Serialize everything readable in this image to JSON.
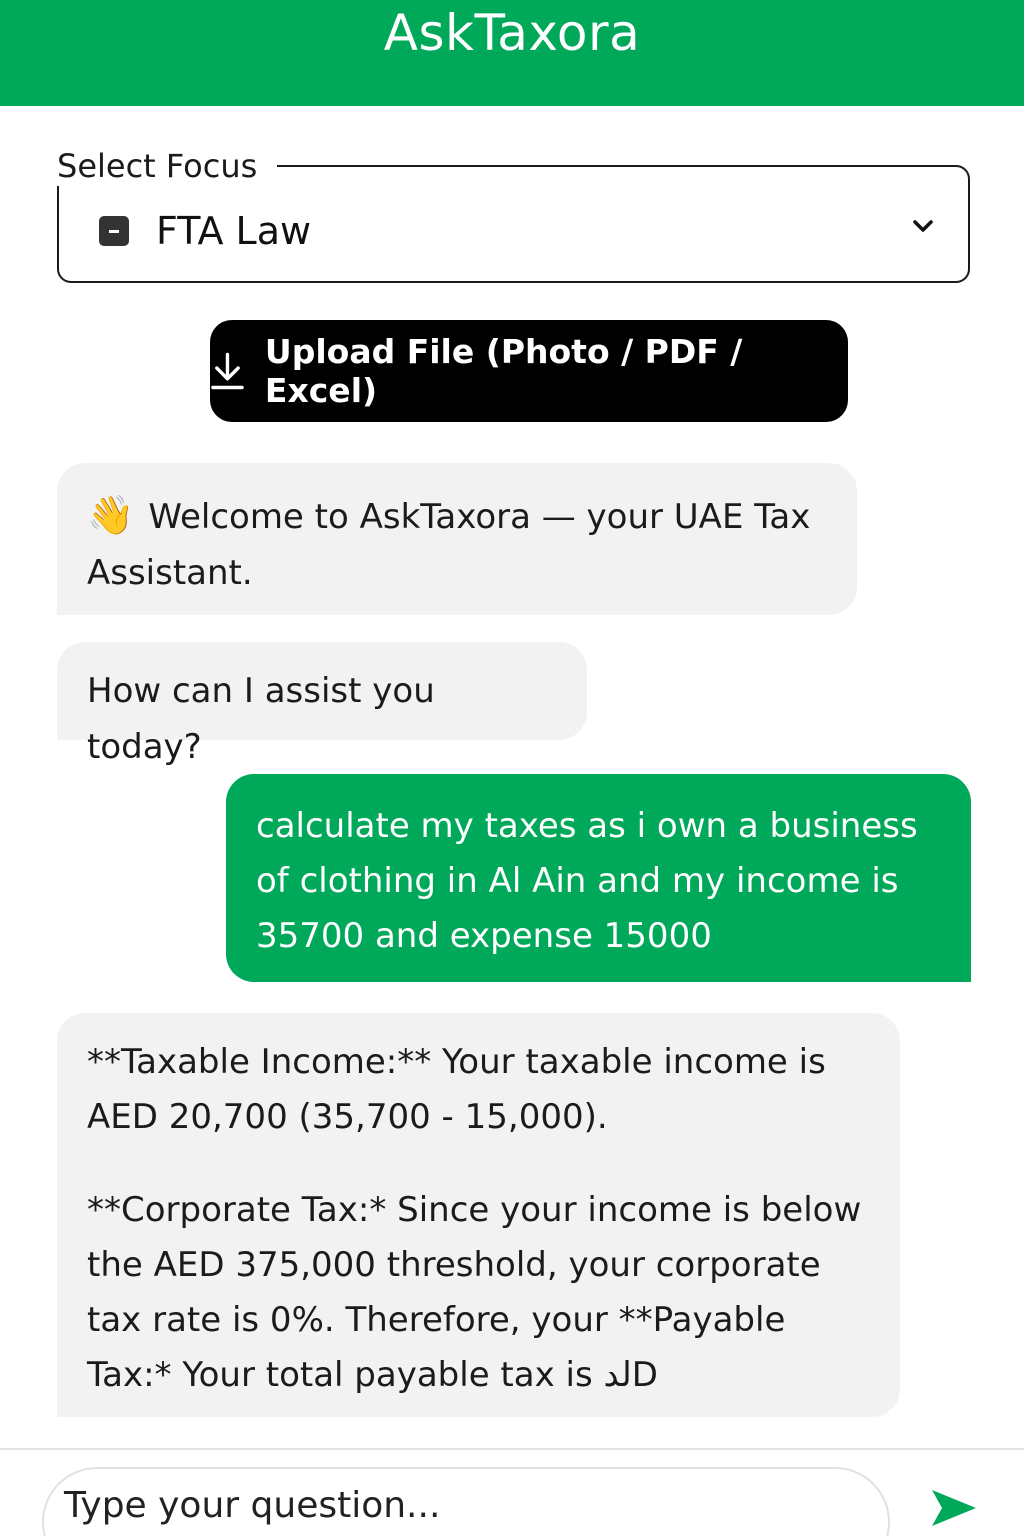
{
  "header": {
    "title": "AskTaxora"
  },
  "focus": {
    "label": "Select Focus",
    "value": "FTA Law"
  },
  "upload": {
    "label": "Upload File (Photo / PDF / Excel)"
  },
  "chat": {
    "welcome_emoji": "👋",
    "welcome_text": "Welcome to AskTaxora — your UAE Tax Assistant.",
    "prompt_text": "How can I assist you today?",
    "user_message": "calculate my taxes as i own a business of clothing in Al Ain and my income is 35700 and expense 15000",
    "reply_paragraph_1": "**Taxable Income:** Your taxable income is AED 20,700 (35,700 - 15,000).",
    "reply_paragraph_2": "**Corporate Tax:* Since your income is below the AED 375,000 threshold, your corporate tax rate is 0%. Therefore, your **Payable Tax:* Your total payable tax is لدD"
  },
  "input": {
    "placeholder": "Type your question..."
  },
  "colors": {
    "brand_green": "#00a85a",
    "bubble_gray": "#f2f2f2",
    "button_black": "#000000"
  }
}
